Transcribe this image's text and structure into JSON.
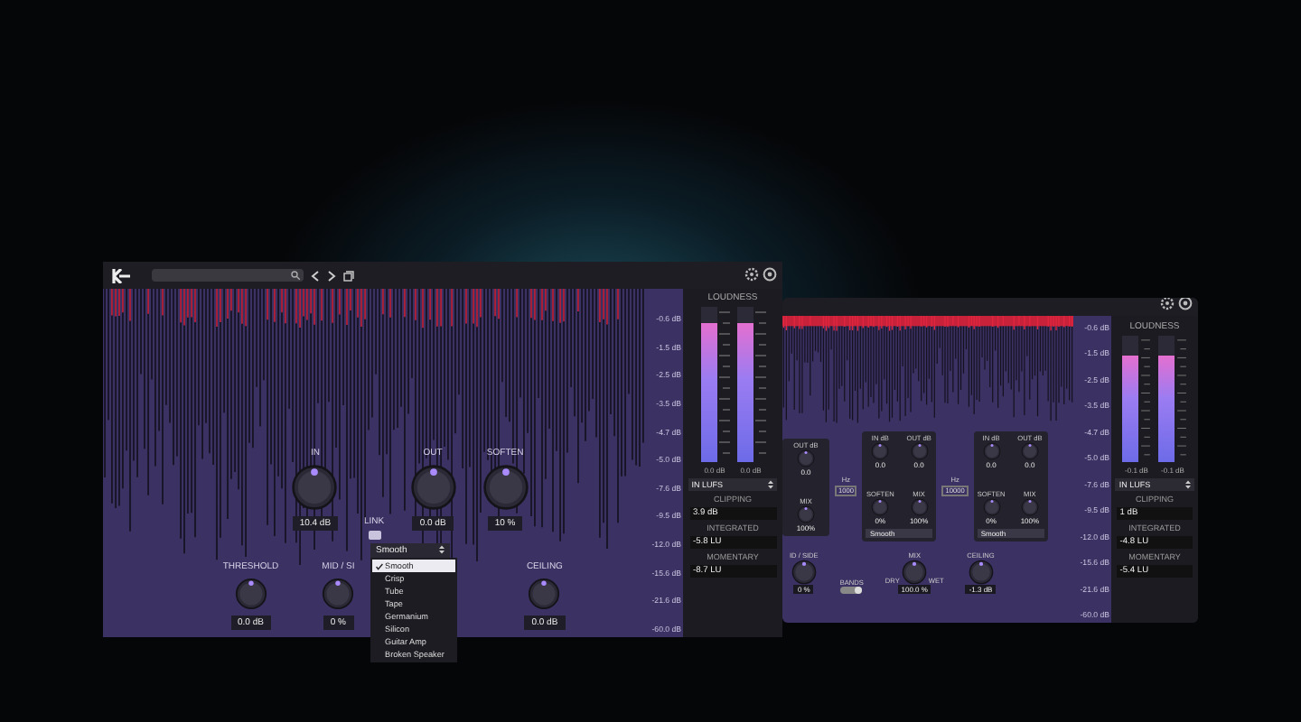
{
  "front_plugin": {
    "scale_labels": [
      "-0.6 dB",
      "-1.5 dB",
      "-2.5 dB",
      "-3.5 dB",
      "-4.7 dB",
      "-5.0 dB",
      "-7.6 dB",
      "-9.5 dB",
      "-12.0 dB",
      "-15.6 dB",
      "-21.6 dB",
      "-60.0 dB"
    ],
    "knobs": [
      {
        "label": "IN",
        "value": "10.4 dB"
      },
      {
        "label": "OUT",
        "value": "0.0 dB"
      },
      {
        "label": "SOFTEN",
        "value": "10 %"
      }
    ],
    "link": {
      "label": "LINK",
      "on": true
    },
    "mode_dropdown": {
      "value": "Smooth",
      "expanded": true,
      "options": [
        {
          "label": "Smooth",
          "selected": true
        },
        {
          "label": "Crisp",
          "selected": false
        },
        {
          "label": "Tube",
          "selected": false
        },
        {
          "label": "Tape",
          "selected": false
        },
        {
          "label": "Germanium",
          "selected": false
        },
        {
          "label": "Silicon",
          "selected": false
        },
        {
          "label": "Guitar Amp",
          "selected": false
        },
        {
          "label": "Broken Speaker",
          "selected": false
        }
      ]
    },
    "bottom_knobs": [
      {
        "label": "THRESHOLD",
        "value": "0.0 dB"
      },
      {
        "label": "MID / SI",
        "value": "0 %"
      },
      {
        "label": "CEILING",
        "value": "0.0 dB"
      }
    ],
    "loudness": {
      "title": "LOUDNESS",
      "meters": [
        {
          "level": 0.9,
          "reading": "0.0 dB"
        },
        {
          "level": 0.9,
          "reading": "0.0 dB"
        }
      ],
      "unit": "IN LUFS",
      "stats": [
        {
          "label": "CLIPPING",
          "value": "3.9 dB"
        },
        {
          "label": "INTEGRATED",
          "value": "-5.8 LU"
        },
        {
          "label": "MOMENTARY",
          "value": "-8.7 LU"
        }
      ]
    }
  },
  "back_plugin": {
    "scale_labels": [
      "-0.6 dB",
      "-1.5 dB",
      "-2.5 dB",
      "-3.5 dB",
      "-4.7 dB",
      "-5.0 dB",
      "-7.6 dB",
      "-9.5 dB",
      "-12.0 dB",
      "-15.6 dB",
      "-21.6 dB",
      "-60.0 dB"
    ],
    "bands": [
      {
        "kind": "partial",
        "knobs": [
          {
            "label": "OUT dB",
            "value": "0.0"
          },
          {
            "label": "MIX",
            "value": "100%"
          }
        ]
      },
      {
        "kind": "full",
        "knobs": [
          {
            "label": "IN dB",
            "value": "0.0"
          },
          {
            "label": "OUT dB",
            "value": "0.0"
          },
          {
            "label": "SOFTEN",
            "value": "0%"
          },
          {
            "label": "MIX",
            "value": "100%"
          }
        ],
        "mode": "Smooth"
      },
      {
        "kind": "full",
        "knobs": [
          {
            "label": "IN dB",
            "value": "0.0"
          },
          {
            "label": "OUT dB",
            "value": "0.0"
          },
          {
            "label": "SOFTEN",
            "value": "0%"
          },
          {
            "label": "MIX",
            "value": "100%"
          }
        ],
        "mode": "Smooth"
      }
    ],
    "crossovers": [
      {
        "unit": "Hz",
        "value": "1000"
      },
      {
        "unit": "Hz",
        "value": "10000"
      }
    ],
    "bottom": [
      {
        "label": "ID / SIDE",
        "value": "0 %"
      },
      {
        "label": "MIX",
        "value": "100.0 %"
      },
      {
        "label": "CEILING",
        "value": "-1.3 dB"
      }
    ],
    "bands_label": "BANDS",
    "bands_switch": {
      "on": true
    },
    "dry_label": "DRY",
    "wet_label": "WET",
    "loudness": {
      "title": "LOUDNESS",
      "meters": [
        {
          "level": 0.85,
          "reading": "-0.1 dB"
        },
        {
          "level": 0.85,
          "reading": "-0.1 dB"
        }
      ],
      "unit": "IN LUFS",
      "stats": [
        {
          "label": "CLIPPING",
          "value": "1 dB"
        },
        {
          "label": "INTEGRATED",
          "value": "-4.8 LU"
        },
        {
          "label": "MOMENTARY",
          "value": "-5.4 LU"
        }
      ]
    }
  }
}
